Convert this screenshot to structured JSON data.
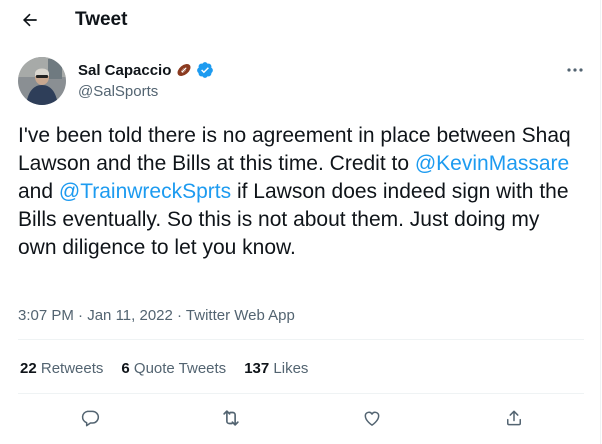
{
  "header": {
    "title": "Tweet"
  },
  "author": {
    "display_name": "Sal Capaccio",
    "handle": "@SalSports",
    "emoji": "football",
    "verified": true
  },
  "tweet": {
    "text_1": "I've been told there is no agreement in place between Shaq Lawson and the Bills at this time. Credit to ",
    "mention_1": "@KevinMassare",
    "text_2": " and ",
    "mention_2": "@TrainwreckSprts",
    "text_3": " if Lawson does indeed sign with the Bills eventually. So this is not about them. Just doing my own diligence to let you know."
  },
  "meta": {
    "time": "3:07 PM",
    "separator_1": " · ",
    "date": "Jan 11, 2022",
    "separator_2": " · ",
    "source": "Twitter Web App"
  },
  "stats": {
    "retweets_count": "22",
    "retweets_label": "Retweets",
    "quote_count": "6",
    "quote_label": "Quote Tweets",
    "likes_count": "137",
    "likes_label": "Likes"
  },
  "icons": {
    "back": "arrow-left-icon",
    "more": "more-horizontal-icon",
    "reply": "reply-icon",
    "retweet": "retweet-icon",
    "like": "heart-icon",
    "share": "share-icon"
  },
  "colors": {
    "accent": "#1d9bf0",
    "text": "#0f1419",
    "secondary": "#536471",
    "divider": "#eff3f4"
  }
}
